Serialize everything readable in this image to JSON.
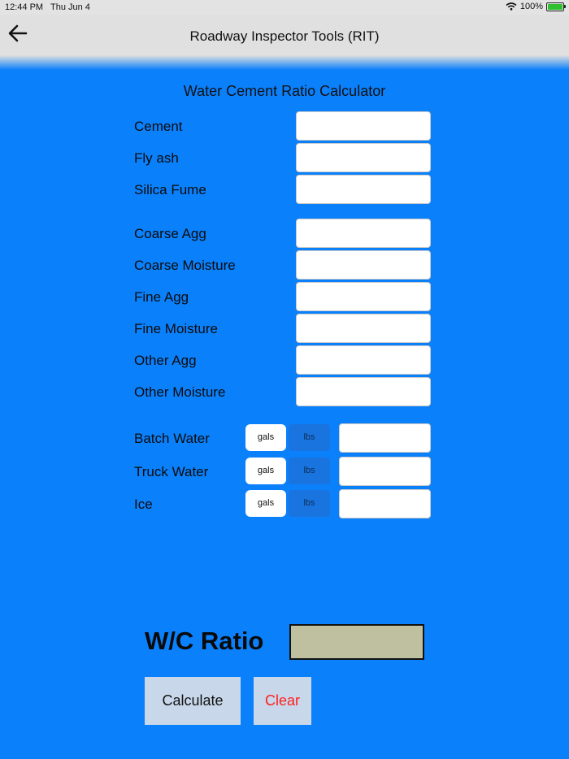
{
  "status_bar": {
    "time": "12:44 PM",
    "date": "Thu Jun 4",
    "battery": "100%"
  },
  "nav": {
    "title": "Roadway Inspector Tools (RIT)",
    "back_icon": "arrow-left-icon"
  },
  "calculator": {
    "title": "Water Cement Ratio Calculator",
    "fields": [
      {
        "label": "Cement",
        "value": ""
      },
      {
        "label": "Fly ash",
        "value": ""
      },
      {
        "label": "Silica Fume",
        "value": ""
      },
      {
        "label": "Coarse Agg",
        "value": ""
      },
      {
        "label": "Coarse Moisture",
        "value": ""
      },
      {
        "label": "Fine Agg",
        "value": ""
      },
      {
        "label": "Fine Moisture",
        "value": ""
      },
      {
        "label": "Other Agg",
        "value": ""
      },
      {
        "label": "Other Moisture",
        "value": ""
      }
    ],
    "water_fields": [
      {
        "label": "Batch Water",
        "unit_a": "gals",
        "unit_b": "lbs",
        "selected": "gals",
        "value": ""
      },
      {
        "label": "Truck Water",
        "unit_a": "gals",
        "unit_b": "lbs",
        "selected": "gals",
        "value": ""
      },
      {
        "label": "Ice",
        "unit_a": "gals",
        "unit_b": "lbs",
        "selected": "gals",
        "value": ""
      }
    ],
    "result_label": "W/C Ratio",
    "result_value": "",
    "calculate_label": "Calculate",
    "clear_label": "Clear"
  },
  "colors": {
    "background": "#0b80fb",
    "result_box": "#bec09f",
    "clear_text": "#ff1e1e",
    "button_bg": "#c8d8ea"
  }
}
